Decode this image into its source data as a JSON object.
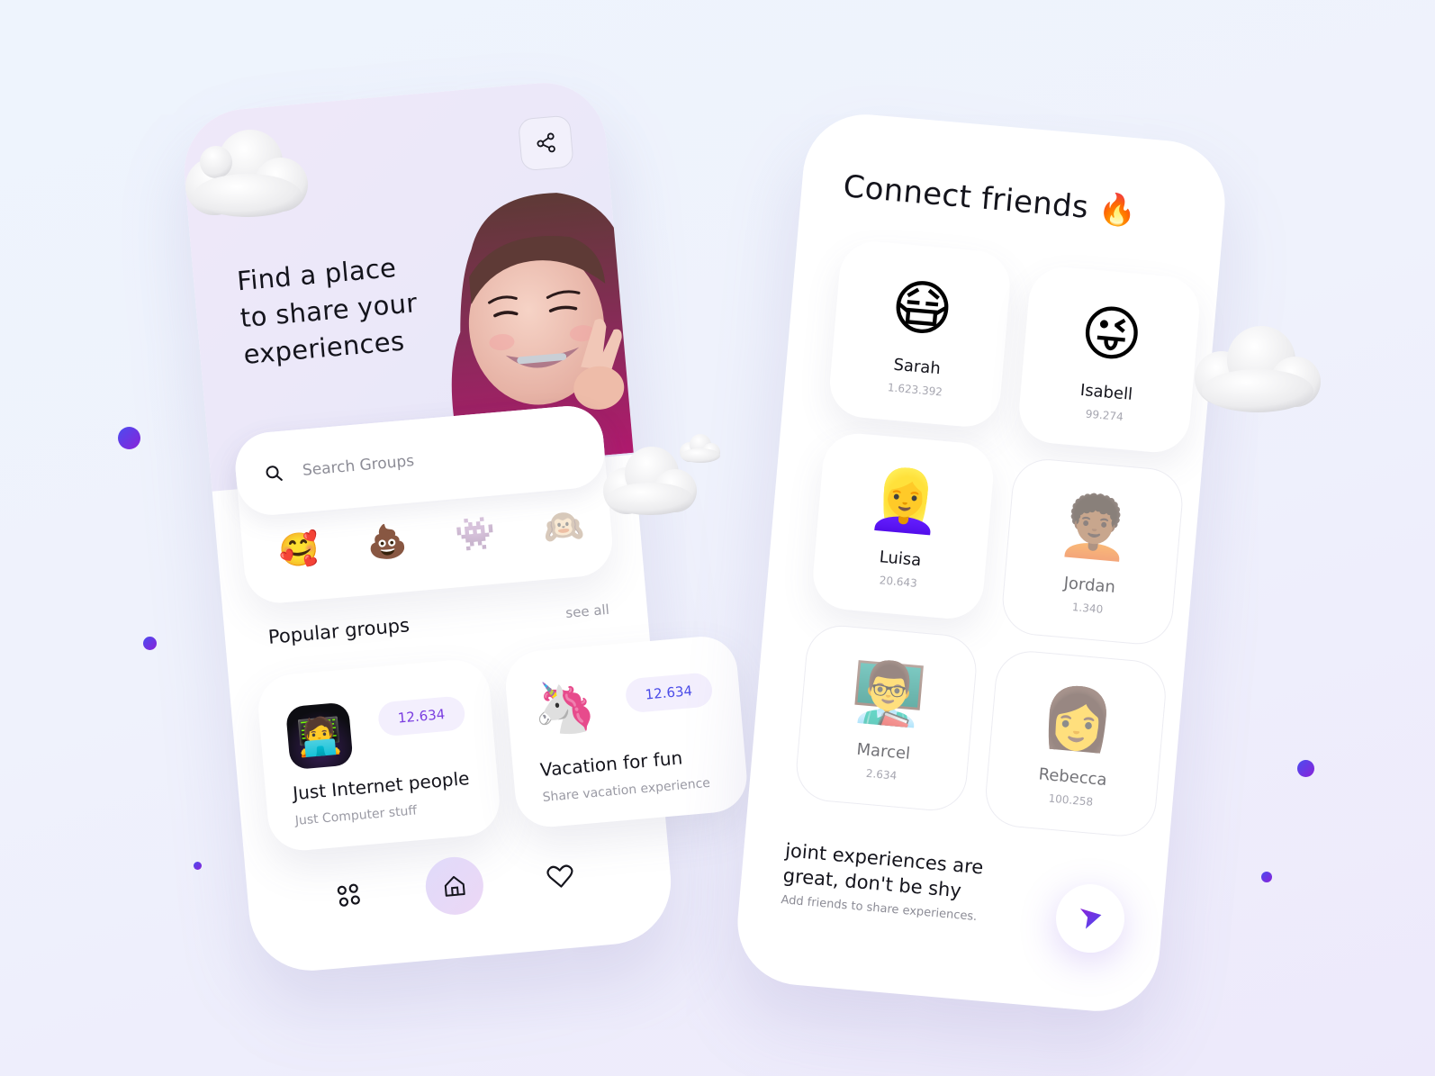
{
  "left_screen": {
    "hero": {
      "title_lines": [
        "Find a place",
        "to share your",
        "experiences"
      ],
      "share_icon": "share-icon",
      "illustration": "smiling-girl-memoji"
    },
    "search": {
      "icon": "search-icon",
      "placeholder": "Search Groups",
      "value": ""
    },
    "emoji_filters": [
      {
        "emoji": "🥰",
        "name": "smiling-face-hearts",
        "faded": false
      },
      {
        "emoji": "💩",
        "name": "poop",
        "faded": false
      },
      {
        "emoji": "👾",
        "name": "alien-monster",
        "faded": true
      },
      {
        "emoji": "🙉",
        "name": "hear-no-evil-monkey",
        "faded": true
      }
    ],
    "popular": {
      "title": "Popular groups",
      "see_all": "see all",
      "groups": [
        {
          "avatar": "🧑‍💻",
          "count": "12.634",
          "name": "Just Internet people",
          "description": "Just Computer stuff"
        },
        {
          "avatar": "🦄",
          "count": "12.634",
          "name": "Vacation for fun",
          "description": "Share vacation experience"
        }
      ]
    },
    "nav": [
      {
        "icon": "grid-dots-icon",
        "active": false
      },
      {
        "icon": "home-icon",
        "active": true
      },
      {
        "icon": "heart-icon",
        "active": false
      }
    ]
  },
  "right_screen": {
    "title": "Connect friends",
    "title_emoji": "🔥",
    "friends": [
      {
        "name": "Sarah",
        "count": "1.623.392",
        "face": "😷",
        "faded": false
      },
      {
        "name": "Isabell",
        "count": "99.274",
        "face": "😜",
        "faded": false
      },
      {
        "name": "Luisa",
        "count": "20.643",
        "face": "👱‍♀️",
        "faded": false
      },
      {
        "name": "Jordan",
        "count": "1.340",
        "face": "🧑🏾‍🦱",
        "faded": true
      },
      {
        "name": "Marcel",
        "count": "2.634",
        "face": "👨‍🏫",
        "faded": true
      },
      {
        "name": "Rebecca",
        "count": "100.258",
        "face": "👩",
        "faded": true
      }
    ],
    "cta": {
      "title": "joint experiences are great, don't be shy",
      "subtitle": "Add friends to share experiences.",
      "button_icon": "send-icon"
    }
  },
  "colors": {
    "accent_purple": "#7a3de0",
    "accent_blue": "#4b4ce8",
    "pill_bg": "#f3effd",
    "nav_active_bg": "#e4daf8"
  }
}
